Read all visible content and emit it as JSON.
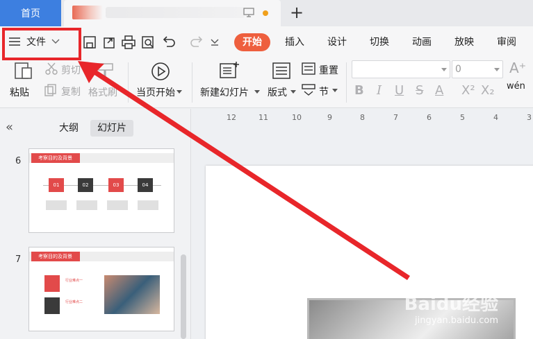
{
  "tabs": {
    "home": "首页"
  },
  "menu": {
    "file": "文件",
    "tabs": [
      "开始",
      "插入",
      "设计",
      "切换",
      "动画",
      "放映",
      "审阅"
    ]
  },
  "ribbon": {
    "paste": "粘贴",
    "cut": "剪切",
    "copy": "复制",
    "format_painter": "格式刷",
    "from_current": "当页开始",
    "new_slide": "新建幻灯片",
    "layout": "版式",
    "reset": "重置",
    "section": "节",
    "font_size": "0",
    "pinyin": "wén"
  },
  "panel": {
    "outline_tab": "大纲",
    "slides_tab": "幻灯片",
    "slides": [
      {
        "number": "6",
        "title": "考察目的及背景",
        "items": [
          "01",
          "02",
          "03",
          "04"
        ]
      },
      {
        "number": "7",
        "title": "考察目的及背景",
        "items": [
          "行业难点一",
          "行业难点二"
        ]
      }
    ]
  },
  "ruler": [
    "12",
    "11",
    "10",
    "9",
    "8",
    "7",
    "6",
    "5",
    "4",
    "3"
  ],
  "watermark": {
    "brand": "Baidu经验",
    "url": "jingyan.baidu.com"
  },
  "colors": {
    "accent": "#ee5f3e",
    "home_tab": "#3d7fe0",
    "annotation": "#e8262a"
  }
}
